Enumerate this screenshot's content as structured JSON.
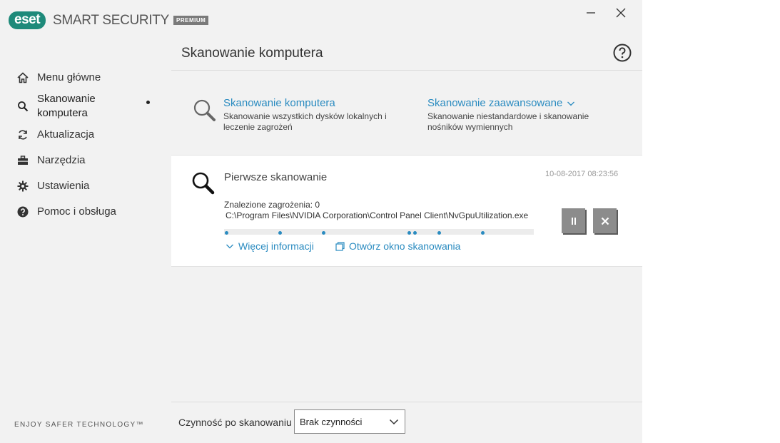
{
  "app": {
    "brand": "eset",
    "product": "SMART SECURITY",
    "edition": "PREMIUM",
    "tagline": "ENJOY SAFER TECHNOLOGY™",
    "window": {
      "minimize_icon": "minimize-icon",
      "close_icon": "close-icon"
    }
  },
  "colors": {
    "brand": "#1e8a7a",
    "link": "#2a8bc0",
    "button": "#8c8c8c"
  },
  "sidebar": {
    "items": [
      {
        "label": "Menu główne",
        "icon": "home-icon"
      },
      {
        "label": "Skanowanie komputera",
        "icon": "search-icon",
        "active": true
      },
      {
        "label": "Aktualizacja",
        "icon": "refresh-icon"
      },
      {
        "label": "Narzędzia",
        "icon": "toolbox-icon"
      },
      {
        "label": "Ustawienia",
        "icon": "gear-icon"
      },
      {
        "label": "Pomoc i obsługa",
        "icon": "help-circle-icon"
      }
    ]
  },
  "main": {
    "title": "Skanowanie komputera",
    "help_icon": "help-icon",
    "options": [
      {
        "title": "Skanowanie komputera",
        "desc": "Skanowanie wszystkich dysków lokalnych i leczenie zagrożeń"
      },
      {
        "title": "Skanowanie zaawansowane",
        "desc": "Skanowanie niestandardowe i skanowanie nośników wymiennych"
      }
    ],
    "scan": {
      "title": "Pierwsze skanowanie",
      "date": "10-08-2017 08:23:56",
      "threats": "Znalezione zagrożenia: 0",
      "path": "C:\\Program Files\\NVIDIA Corporation\\Control Panel Client\\NvGpuUtilization.exe",
      "more_link": "Więcej informacji",
      "window_link": "Otwórz okno skanowania",
      "pause_icon": "pause-icon",
      "stop_icon": "stop-icon"
    }
  },
  "footer": {
    "after_scan_label": "Czynność po skanowaniu",
    "after_scan_value": "Brak czynności"
  }
}
